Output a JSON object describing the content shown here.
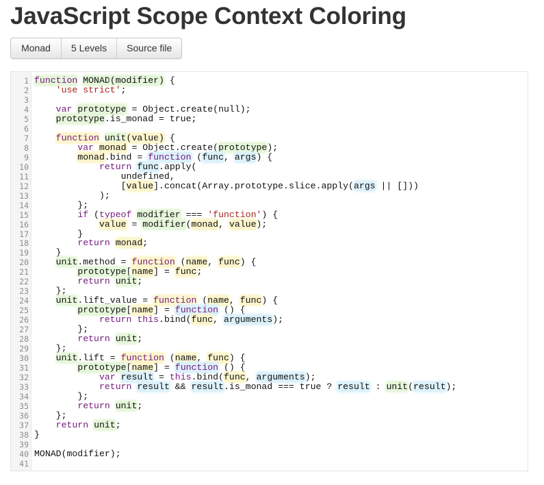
{
  "page": {
    "title": "JavaScript Scope Context Coloring"
  },
  "toolbar": {
    "buttons": [
      {
        "label": "Monad"
      },
      {
        "label": "5 Levels"
      },
      {
        "label": "Source file"
      }
    ]
  },
  "colors": {
    "keyword": "#74197d",
    "string": "#a8231c",
    "text": "#111111",
    "scope_level_0": "#e5f6da",
    "scope_level_1": "#fcf5cc",
    "scope_level_2": "#dcf1fa",
    "gutter_bg": "#f5f5f5",
    "line_number": "#8c8c8c"
  },
  "code": {
    "language": "javascript",
    "lines": [
      {
        "n": "1",
        "tokens": [
          [
            "function",
            "kw",
            0
          ],
          [
            " ",
            "",
            -1
          ],
          [
            "MONAD",
            "",
            0
          ],
          [
            "(",
            "",
            0
          ],
          [
            "modifier",
            "",
            0
          ],
          [
            ")",
            "",
            0
          ],
          [
            " {",
            "",
            -1
          ]
        ]
      },
      {
        "n": "2",
        "tokens": [
          [
            "    ",
            "",
            -1
          ],
          [
            "'use strict'",
            "str",
            -1
          ],
          [
            ";",
            "",
            -1
          ]
        ]
      },
      {
        "n": "3",
        "tokens": []
      },
      {
        "n": "4",
        "tokens": [
          [
            "    ",
            "",
            -1
          ],
          [
            "var",
            "kw",
            -1
          ],
          [
            " ",
            "",
            -1
          ],
          [
            "prototype",
            "",
            0
          ],
          [
            " = Object.create(null);",
            "",
            -1
          ]
        ]
      },
      {
        "n": "5",
        "tokens": [
          [
            "    ",
            "",
            -1
          ],
          [
            "prototype",
            "",
            0
          ],
          [
            ".is_monad = true;",
            "",
            -1
          ]
        ]
      },
      {
        "n": "6",
        "tokens": []
      },
      {
        "n": "7",
        "tokens": [
          [
            "    ",
            "",
            -1
          ],
          [
            "function",
            "kw",
            1
          ],
          [
            " ",
            "",
            -1
          ],
          [
            "unit",
            "",
            0
          ],
          [
            "(",
            "",
            1
          ],
          [
            "value",
            "",
            1
          ],
          [
            ")",
            "",
            1
          ],
          [
            " {",
            "",
            -1
          ]
        ]
      },
      {
        "n": "8",
        "tokens": [
          [
            "        ",
            "",
            -1
          ],
          [
            "var",
            "kw",
            -1
          ],
          [
            " ",
            "",
            -1
          ],
          [
            "monad",
            "",
            1
          ],
          [
            " = Object.create(",
            "",
            -1
          ],
          [
            "prototype",
            "",
            0
          ],
          [
            ");",
            "",
            -1
          ]
        ]
      },
      {
        "n": "9",
        "tokens": [
          [
            "        ",
            "",
            -1
          ],
          [
            "monad",
            "",
            1
          ],
          [
            ".bind = ",
            "",
            -1
          ],
          [
            "function",
            "kw",
            2
          ],
          [
            " (",
            "",
            -1
          ],
          [
            "func",
            "",
            2
          ],
          [
            ", ",
            "",
            -1
          ],
          [
            "args",
            "",
            2
          ],
          [
            ") {",
            "",
            -1
          ]
        ]
      },
      {
        "n": "10",
        "tokens": [
          [
            "            ",
            "",
            -1
          ],
          [
            "return",
            "kw",
            -1
          ],
          [
            " ",
            "",
            -1
          ],
          [
            "func",
            "",
            2
          ],
          [
            ".apply(",
            "",
            -1
          ]
        ]
      },
      {
        "n": "11",
        "tokens": [
          [
            "                undefined,",
            "",
            -1
          ]
        ]
      },
      {
        "n": "12",
        "tokens": [
          [
            "                [",
            "",
            -1
          ],
          [
            "value",
            "",
            1
          ],
          [
            "].concat(Array.prototype.slice.apply(",
            "",
            -1
          ],
          [
            "args",
            "",
            2
          ],
          [
            " || []))",
            "",
            -1
          ]
        ]
      },
      {
        "n": "13",
        "tokens": [
          [
            "            );",
            "",
            -1
          ]
        ]
      },
      {
        "n": "14",
        "tokens": [
          [
            "        };",
            "",
            -1
          ]
        ]
      },
      {
        "n": "15",
        "tokens": [
          [
            "        ",
            "",
            -1
          ],
          [
            "if",
            "kw",
            -1
          ],
          [
            " (",
            "",
            -1
          ],
          [
            "typeof",
            "kw",
            -1
          ],
          [
            " ",
            "",
            -1
          ],
          [
            "modifier",
            "",
            0
          ],
          [
            " === ",
            "",
            -1
          ],
          [
            "'function'",
            "str",
            -1
          ],
          [
            ") {",
            "",
            -1
          ]
        ]
      },
      {
        "n": "16",
        "tokens": [
          [
            "            ",
            "",
            -1
          ],
          [
            "value",
            "",
            1
          ],
          [
            " = ",
            "",
            -1
          ],
          [
            "modifier",
            "",
            0
          ],
          [
            "(",
            "",
            -1
          ],
          [
            "monad",
            "",
            1
          ],
          [
            ", ",
            "",
            -1
          ],
          [
            "value",
            "",
            1
          ],
          [
            ");",
            "",
            -1
          ]
        ]
      },
      {
        "n": "17",
        "tokens": [
          [
            "        }",
            "",
            -1
          ]
        ]
      },
      {
        "n": "18",
        "tokens": [
          [
            "        ",
            "",
            -1
          ],
          [
            "return",
            "kw",
            -1
          ],
          [
            " ",
            "",
            -1
          ],
          [
            "monad",
            "",
            1
          ],
          [
            ";",
            "",
            -1
          ]
        ]
      },
      {
        "n": "19",
        "tokens": [
          [
            "    }",
            "",
            -1
          ]
        ]
      },
      {
        "n": "20",
        "tokens": [
          [
            "    ",
            "",
            -1
          ],
          [
            "unit",
            "",
            0
          ],
          [
            ".method = ",
            "",
            -1
          ],
          [
            "function",
            "kw",
            1
          ],
          [
            " (",
            "",
            -1
          ],
          [
            "name",
            "",
            1
          ],
          [
            ", ",
            "",
            -1
          ],
          [
            "func",
            "",
            1
          ],
          [
            ") {",
            "",
            -1
          ]
        ]
      },
      {
        "n": "21",
        "tokens": [
          [
            "        ",
            "",
            -1
          ],
          [
            "prototype",
            "",
            0
          ],
          [
            "[",
            "",
            -1
          ],
          [
            "name",
            "",
            1
          ],
          [
            "] = ",
            "",
            -1
          ],
          [
            "func",
            "",
            1
          ],
          [
            ";",
            "",
            -1
          ]
        ]
      },
      {
        "n": "22",
        "tokens": [
          [
            "        ",
            "",
            -1
          ],
          [
            "return",
            "kw",
            -1
          ],
          [
            " ",
            "",
            -1
          ],
          [
            "unit",
            "",
            0
          ],
          [
            ";",
            "",
            -1
          ]
        ]
      },
      {
        "n": "23",
        "tokens": [
          [
            "    };",
            "",
            -1
          ]
        ]
      },
      {
        "n": "24",
        "tokens": [
          [
            "    ",
            "",
            -1
          ],
          [
            "unit",
            "",
            0
          ],
          [
            ".lift_value = ",
            "",
            -1
          ],
          [
            "function",
            "kw",
            1
          ],
          [
            " (",
            "",
            -1
          ],
          [
            "name",
            "",
            1
          ],
          [
            ", ",
            "",
            -1
          ],
          [
            "func",
            "",
            1
          ],
          [
            ") {",
            "",
            -1
          ]
        ]
      },
      {
        "n": "25",
        "tokens": [
          [
            "        ",
            "",
            -1
          ],
          [
            "prototype",
            "",
            0
          ],
          [
            "[",
            "",
            -1
          ],
          [
            "name",
            "",
            1
          ],
          [
            "] = ",
            "",
            -1
          ],
          [
            "function",
            "kw",
            2
          ],
          [
            " () {",
            "",
            -1
          ]
        ]
      },
      {
        "n": "26",
        "tokens": [
          [
            "            ",
            "",
            -1
          ],
          [
            "return",
            "kw",
            -1
          ],
          [
            " ",
            "",
            -1
          ],
          [
            "this",
            "kw",
            -1
          ],
          [
            ".bind(",
            "",
            -1
          ],
          [
            "func",
            "",
            1
          ],
          [
            ", ",
            "",
            -1
          ],
          [
            "arguments",
            "",
            2
          ],
          [
            ");",
            "",
            -1
          ]
        ]
      },
      {
        "n": "27",
        "tokens": [
          [
            "        };",
            "",
            -1
          ]
        ]
      },
      {
        "n": "28",
        "tokens": [
          [
            "        ",
            "",
            -1
          ],
          [
            "return",
            "kw",
            -1
          ],
          [
            " ",
            "",
            -1
          ],
          [
            "unit",
            "",
            0
          ],
          [
            ";",
            "",
            -1
          ]
        ]
      },
      {
        "n": "29",
        "tokens": [
          [
            "    };",
            "",
            -1
          ]
        ]
      },
      {
        "n": "30",
        "tokens": [
          [
            "    ",
            "",
            -1
          ],
          [
            "unit",
            "",
            0
          ],
          [
            ".lift = ",
            "",
            -1
          ],
          [
            "function",
            "kw",
            1
          ],
          [
            " (",
            "",
            -1
          ],
          [
            "name",
            "",
            1
          ],
          [
            ", ",
            "",
            -1
          ],
          [
            "func",
            "",
            1
          ],
          [
            ") {",
            "",
            -1
          ]
        ]
      },
      {
        "n": "31",
        "tokens": [
          [
            "        ",
            "",
            -1
          ],
          [
            "prototype",
            "",
            0
          ],
          [
            "[",
            "",
            -1
          ],
          [
            "name",
            "",
            1
          ],
          [
            "] = ",
            "",
            -1
          ],
          [
            "function",
            "kw",
            2
          ],
          [
            " () {",
            "",
            -1
          ]
        ]
      },
      {
        "n": "32",
        "tokens": [
          [
            "            ",
            "",
            -1
          ],
          [
            "var",
            "kw",
            -1
          ],
          [
            " ",
            "",
            -1
          ],
          [
            "result",
            "",
            2
          ],
          [
            " = ",
            "",
            -1
          ],
          [
            "this",
            "kw",
            -1
          ],
          [
            ".bind(",
            "",
            -1
          ],
          [
            "func",
            "",
            1
          ],
          [
            ", ",
            "",
            -1
          ],
          [
            "arguments",
            "",
            2
          ],
          [
            ");",
            "",
            -1
          ]
        ]
      },
      {
        "n": "33",
        "tokens": [
          [
            "            ",
            "",
            -1
          ],
          [
            "return",
            "kw",
            -1
          ],
          [
            " ",
            "",
            -1
          ],
          [
            "result",
            "",
            2
          ],
          [
            " && ",
            "",
            -1
          ],
          [
            "result",
            "",
            2
          ],
          [
            ".is_monad === true ? ",
            "",
            -1
          ],
          [
            "result",
            "",
            2
          ],
          [
            " : ",
            "",
            -1
          ],
          [
            "unit",
            "",
            0
          ],
          [
            "(",
            "",
            -1
          ],
          [
            "result",
            "",
            2
          ],
          [
            ");",
            "",
            -1
          ]
        ]
      },
      {
        "n": "34",
        "tokens": [
          [
            "        };",
            "",
            -1
          ]
        ]
      },
      {
        "n": "35",
        "tokens": [
          [
            "        ",
            "",
            -1
          ],
          [
            "return",
            "kw",
            -1
          ],
          [
            " ",
            "",
            -1
          ],
          [
            "unit",
            "",
            0
          ],
          [
            ";",
            "",
            -1
          ]
        ]
      },
      {
        "n": "36",
        "tokens": [
          [
            "    };",
            "",
            -1
          ]
        ]
      },
      {
        "n": "37",
        "tokens": [
          [
            "    ",
            "",
            -1
          ],
          [
            "return",
            "kw",
            -1
          ],
          [
            " ",
            "",
            -1
          ],
          [
            "unit",
            "",
            0
          ],
          [
            ";",
            "",
            -1
          ]
        ]
      },
      {
        "n": "38",
        "tokens": [
          [
            "}",
            "",
            -1
          ]
        ]
      },
      {
        "n": "39",
        "tokens": []
      },
      {
        "n": "40",
        "tokens": [
          [
            "MONAD(modifier);",
            "",
            -1
          ]
        ]
      },
      {
        "n": "41",
        "tokens": []
      }
    ]
  }
}
